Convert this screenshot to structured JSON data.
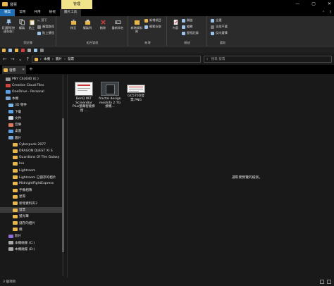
{
  "window": {
    "title": "發票",
    "manage_tab": "管理",
    "controls": [
      "—",
      "▢",
      "✕"
    ]
  },
  "ribbon_tabs": [
    "檔案",
    "常用",
    "共用",
    "檢視",
    "圖片工具"
  ],
  "ribbon": {
    "clipboard": {
      "label": "剪貼簿",
      "pin": "釘選到[快速存取]",
      "copy": "複製",
      "paste": "貼上",
      "cut": "剪下",
      "copy_path": "複製路徑",
      "paste_shortcut": "貼上捷徑"
    },
    "organize": {
      "label": "組合管理",
      "move_to": "移至",
      "copy_to": "複製到",
      "delete": "刪除",
      "rename": "重新命名"
    },
    "new": {
      "label": "新增",
      "new_folder": "新增資料夾",
      "new_item": "新增項目",
      "easy_access": "輕鬆存取"
    },
    "open": {
      "label": "開啟",
      "properties": "內容",
      "open": "開啟",
      "edit": "編輯",
      "history": "歷程記錄"
    },
    "select": {
      "label": "選取",
      "select_all": "全選",
      "select_none": "全部不選",
      "invert": "反向選擇"
    }
  },
  "address": {
    "path": [
      "本機",
      "圖片",
      "發票"
    ],
    "search_placeholder": "搜尋 發票"
  },
  "explorer_tab": {
    "label": "發票",
    "close": "✕",
    "new": "+"
  },
  "nav": {
    "items": [
      {
        "label": "PNY CS3040 (E:)",
        "indent": 1,
        "type": "drive"
      },
      {
        "label": "Creative Cloud Files",
        "indent": 1,
        "type": "cloud"
      },
      {
        "label": "OneDrive - Personal",
        "indent": 1,
        "type": "onedrive"
      },
      {
        "label": "本機",
        "indent": 1,
        "type": "pc"
      },
      {
        "label": "3D 物件",
        "indent": 2,
        "type": "3d"
      },
      {
        "label": "下載",
        "indent": 2,
        "type": "down"
      },
      {
        "label": "文件",
        "indent": 2,
        "type": "doc"
      },
      {
        "label": "音樂",
        "indent": 2,
        "type": "music"
      },
      {
        "label": "桌面",
        "indent": 2,
        "type": "desktop"
      },
      {
        "label": "圖片",
        "indent": 2,
        "type": "pic"
      },
      {
        "label": "Cyberpunk 2077",
        "indent": 3,
        "type": "folder"
      },
      {
        "label": "DRAGON QUEST XI S",
        "indent": 3,
        "type": "folder"
      },
      {
        "label": "Guardians Of The Galaxy",
        "indent": 3,
        "type": "folder"
      },
      {
        "label": "Ina",
        "indent": 3,
        "type": "folder"
      },
      {
        "label": "Lightroom",
        "indent": 3,
        "type": "folder"
      },
      {
        "label": "Lightroom 已儲存的相片",
        "indent": 3,
        "type": "folder"
      },
      {
        "label": "MidnightFightExpress",
        "indent": 3,
        "type": "folder"
      },
      {
        "label": "手機相簿",
        "indent": 3,
        "type": "folder"
      },
      {
        "label": "星際",
        "indent": 3,
        "type": "folder"
      },
      {
        "label": "新增資料夾3",
        "indent": 3,
        "type": "folder"
      },
      {
        "label": "發票",
        "indent": 3,
        "type": "folder",
        "selected": true
      },
      {
        "label": "螢光筆",
        "indent": 3,
        "type": "folder"
      },
      {
        "label": "儲存的相片",
        "indent": 3,
        "type": "folder"
      },
      {
        "label": "橋",
        "indent": 3,
        "type": "folder"
      },
      {
        "label": "影片",
        "indent": 2,
        "type": "video"
      },
      {
        "label": "本機磁碟 (C:)",
        "indent": 2,
        "type": "disk"
      },
      {
        "label": "本機磁碟 (D:)",
        "indent": 2,
        "type": "disk"
      }
    ]
  },
  "files": [
    {
      "name": "BenQ WiT ScreenBar Plus螢幕智能掛燈 ...",
      "thumb": "doc"
    },
    {
      "name": "fractal design meshify 2 TG 接機...",
      "thumb": "case"
    },
    {
      "name": "GC570D發票.PNG",
      "thumb": "invoice"
    }
  ],
  "preview_message": "選取要預覽的檔案。",
  "status": {
    "count": "3 個項目",
    "selected": ""
  },
  "colors": {
    "accent": "#1e6fb8",
    "folder": "#e8b64b",
    "manage": "#f1e38a",
    "background": "#191919"
  }
}
